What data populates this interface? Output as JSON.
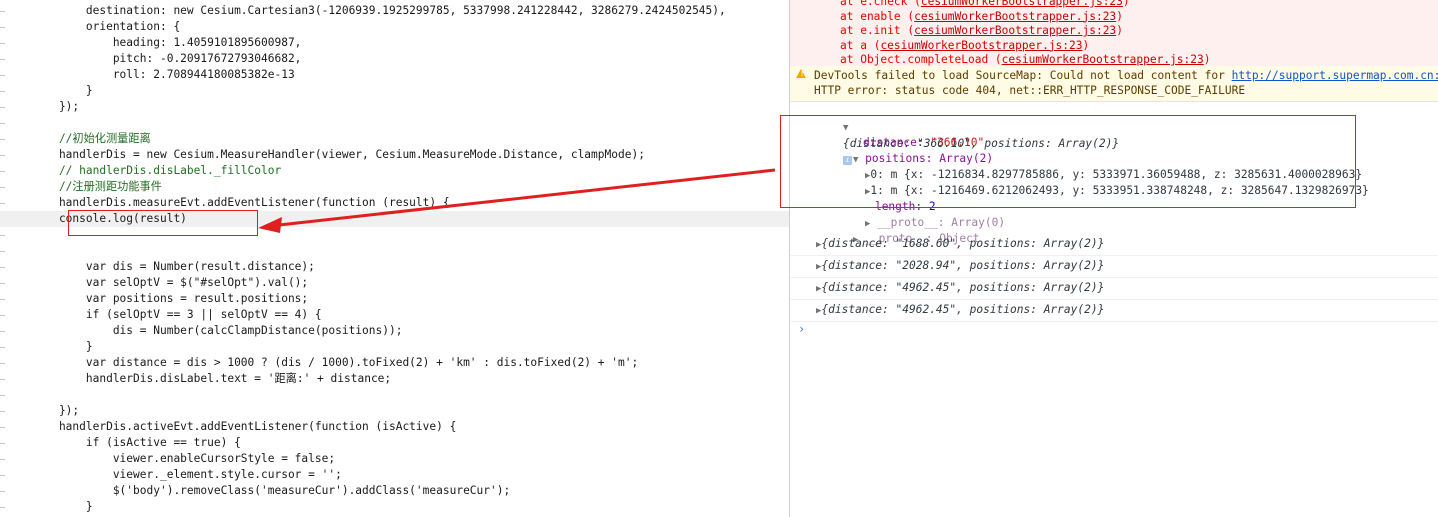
{
  "code_lines": [
    "        destination: new Cesium.Cartesian3(-1206939.1925299785, 5337998.241228442, 3286279.2424502545),",
    "        orientation: {",
    "            heading: 1.4059101895600987,",
    "            pitch: -0.20917672793046682,",
    "            roll: 2.708944180085382e-13",
    "        }",
    "    });",
    "",
    "    //初始化测量距离",
    "    handlerDis = new Cesium.MeasureHandler(viewer, Cesium.MeasureMode.Distance, clampMode);",
    "    // handlerDis.disLabel._fillColor",
    "    //注册测距功能事件",
    "    handlerDis.measureEvt.addEventListener(function (result) {",
    "    console.log(result)",
    "",
    "",
    "        var dis = Number(result.distance);",
    "        var selOptV = $(\"#selOpt\").val();",
    "        var positions = result.positions;",
    "        if (selOptV == 3 || selOptV == 4) {",
    "            dis = Number(calcClampDistance(positions));",
    "        }",
    "        var distance = dis > 1000 ? (dis / 1000).toFixed(2) + 'km' : dis.toFixed(2) + 'm';",
    "        handlerDis.disLabel.text = '距离:' + distance;",
    "",
    "    });",
    "    handlerDis.activeEvt.addEventListener(function (isActive) {",
    "        if (isActive == true) {",
    "            viewer.enableCursorStyle = false;",
    "            viewer._element.style.cursor = '';",
    "            $('body').removeClass('measureCur').addClass('measureCur');",
    "        }"
  ],
  "console": {
    "errors": [
      {
        "prefix": "at e.check ",
        "file": "cesiumWorkerBootstrapper.js:23"
      },
      {
        "prefix": "at enable ",
        "file": "cesiumWorkerBootstrapper.js:23"
      },
      {
        "prefix": "at e.init ",
        "file": "cesiumWorkerBootstrapper.js:23"
      },
      {
        "prefix": "at a ",
        "file": "cesiumWorkerBootstrapper.js:23"
      },
      {
        "prefix": "at Object.completeLoad ",
        "file": "cesiumWorkerBootstrapper.js:23"
      }
    ],
    "warning_line1": "DevTools failed to load SourceMap: Could not load content for ",
    "warning_link": "http://support.supermap.com.cn:80",
    "warning_line2": "HTTP error: status code 404, net::ERR_HTTP_RESPONSE_CODE_FAILURE",
    "expanded": {
      "summary": "{distance: \"366.10\", positions: Array(2)}",
      "distance_key": "distance",
      "distance_val": "\"366.10\"",
      "positions_label": "positions: Array(2)",
      "item0": "0: m {x: -1216834.8297785886, y: 5333971.36059488, z: 3285631.4000028963}",
      "item1": "1: m {x: -1216469.6212062493, y: 5333951.338748248, z: 3285647.1329826973}",
      "length_key": "length",
      "length_val": "2",
      "proto_array": "__proto__: Array(0)",
      "proto_obj": "__proto__: Object"
    },
    "rows": [
      "{distance: \"1688.60\", positions: Array(2)}",
      "{distance: \"2028.94\", positions: Array(2)}",
      "{distance: \"4962.45\", positions: Array(2)}",
      "{distance: \"4962.45\", positions: Array(2)}"
    ],
    "prompt": "›"
  },
  "colors": {
    "annotation_red": "#e02020",
    "error_text": "#ee0000",
    "warning_bg": "#fffbe5"
  }
}
